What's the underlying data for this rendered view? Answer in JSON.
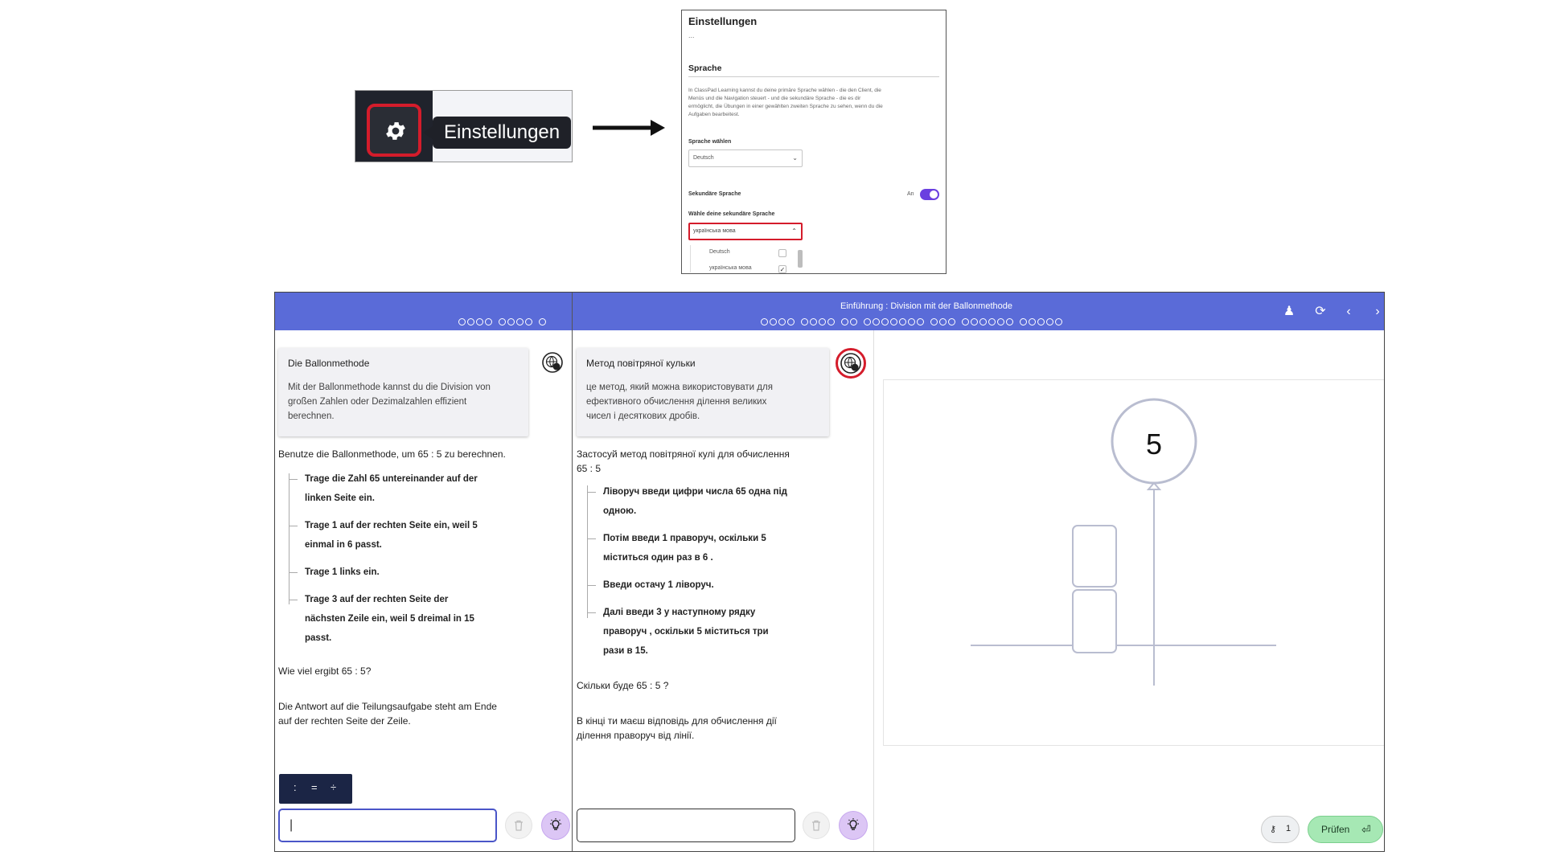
{
  "callout": {
    "tooltip": "Einstellungen",
    "gear_icon": "gear-icon",
    "highlight_color": "#d41c2b"
  },
  "settings": {
    "title": "Einstellungen",
    "dots": "...",
    "section": "Sprache",
    "description": "In ClassPad Learning kannst du deine primäre Sprache wählen - die den Client, die Menüs und die Navigation steuert - und die sekundäre Sprache - die es dir ermöglicht, die Übungen in einer gewählten zweiten Sprache zu sehen, wenn du die Aufgaben bearbeitest.",
    "choose_language_label": "Sprache wählen",
    "primary_language": "Deutsch",
    "secondary_label": "Sekundäre Sprache",
    "toggle_label": "An",
    "choose_secondary_label": "Wähle deine sekundäre Sprache",
    "secondary_language": "українська мова",
    "options": [
      {
        "label": "Deutsch",
        "checked": false
      },
      {
        "label": "українська мова",
        "checked": true
      }
    ],
    "toggle_color": "#6a3fe0"
  },
  "app": {
    "header_title": "Einführung : Division mit der Ballonmethode",
    "header_color": "#5a6bd8",
    "left": {
      "card_title": "Die Ballonmethode",
      "card_body": [
        "Mit der Ballonmethode kannst du die Division von",
        "großen Zahlen oder Dezimalzahlen effizient",
        "berechnen."
      ],
      "intro": "Benutze die Ballonmethode, um 65 : 5 zu berechnen.",
      "steps": [
        [
          "Trage die Zahl 65 untereinander auf der",
          "linken Seite ein."
        ],
        [
          "Trage 1 auf der rechten Seite ein, weil 5",
          "einmal in 6 passt."
        ],
        [
          "Trage 1 links ein."
        ],
        [
          "Trage 3 auf der rechten Seite der",
          "nächsten Zeile ein, weil 5 dreimal in 15",
          "passt."
        ]
      ],
      "question": "Wie viel ergibt 65 : 5?",
      "hint": [
        "Die Antwort auf die Teilungsaufgabe steht am Ende",
        "auf der rechten Seite der Zeile."
      ],
      "operators": [
        ":",
        "=",
        "÷"
      ],
      "answer_value": "|"
    },
    "middle": {
      "card_title": "Метод повітряної кульки",
      "card_body": [
        "це метод, який можна використовувати для",
        "ефективного обчислення ділення великих",
        "чисел і десяткових дробів."
      ],
      "intro": [
        "Застосуй метод повітряної кулі для обчислення",
        "65 : 5"
      ],
      "steps": [
        [
          "Ліворуч введи цифри числа 65 одна під",
          "одною."
        ],
        [
          "Потім введи 1 праворуч, оскільки 5",
          "міститься один раз в 6 ."
        ],
        [
          "Введи остачу 1 ліворуч."
        ],
        [
          "Далі введи 3 у наступному рядку",
          "праворуч , оскільки 5 міститься три",
          "рази в 15."
        ]
      ],
      "question": "Скільки буде 65 : 5 ?",
      "hint": [
        "В кінці ти маєш відповідь для обчислення дії",
        "ділення праворуч від лінії."
      ]
    },
    "canvas": {
      "balloon_value": "5"
    },
    "key_button": "1",
    "check_button": "Prüfen",
    "check_color": "#a6e8b4"
  }
}
